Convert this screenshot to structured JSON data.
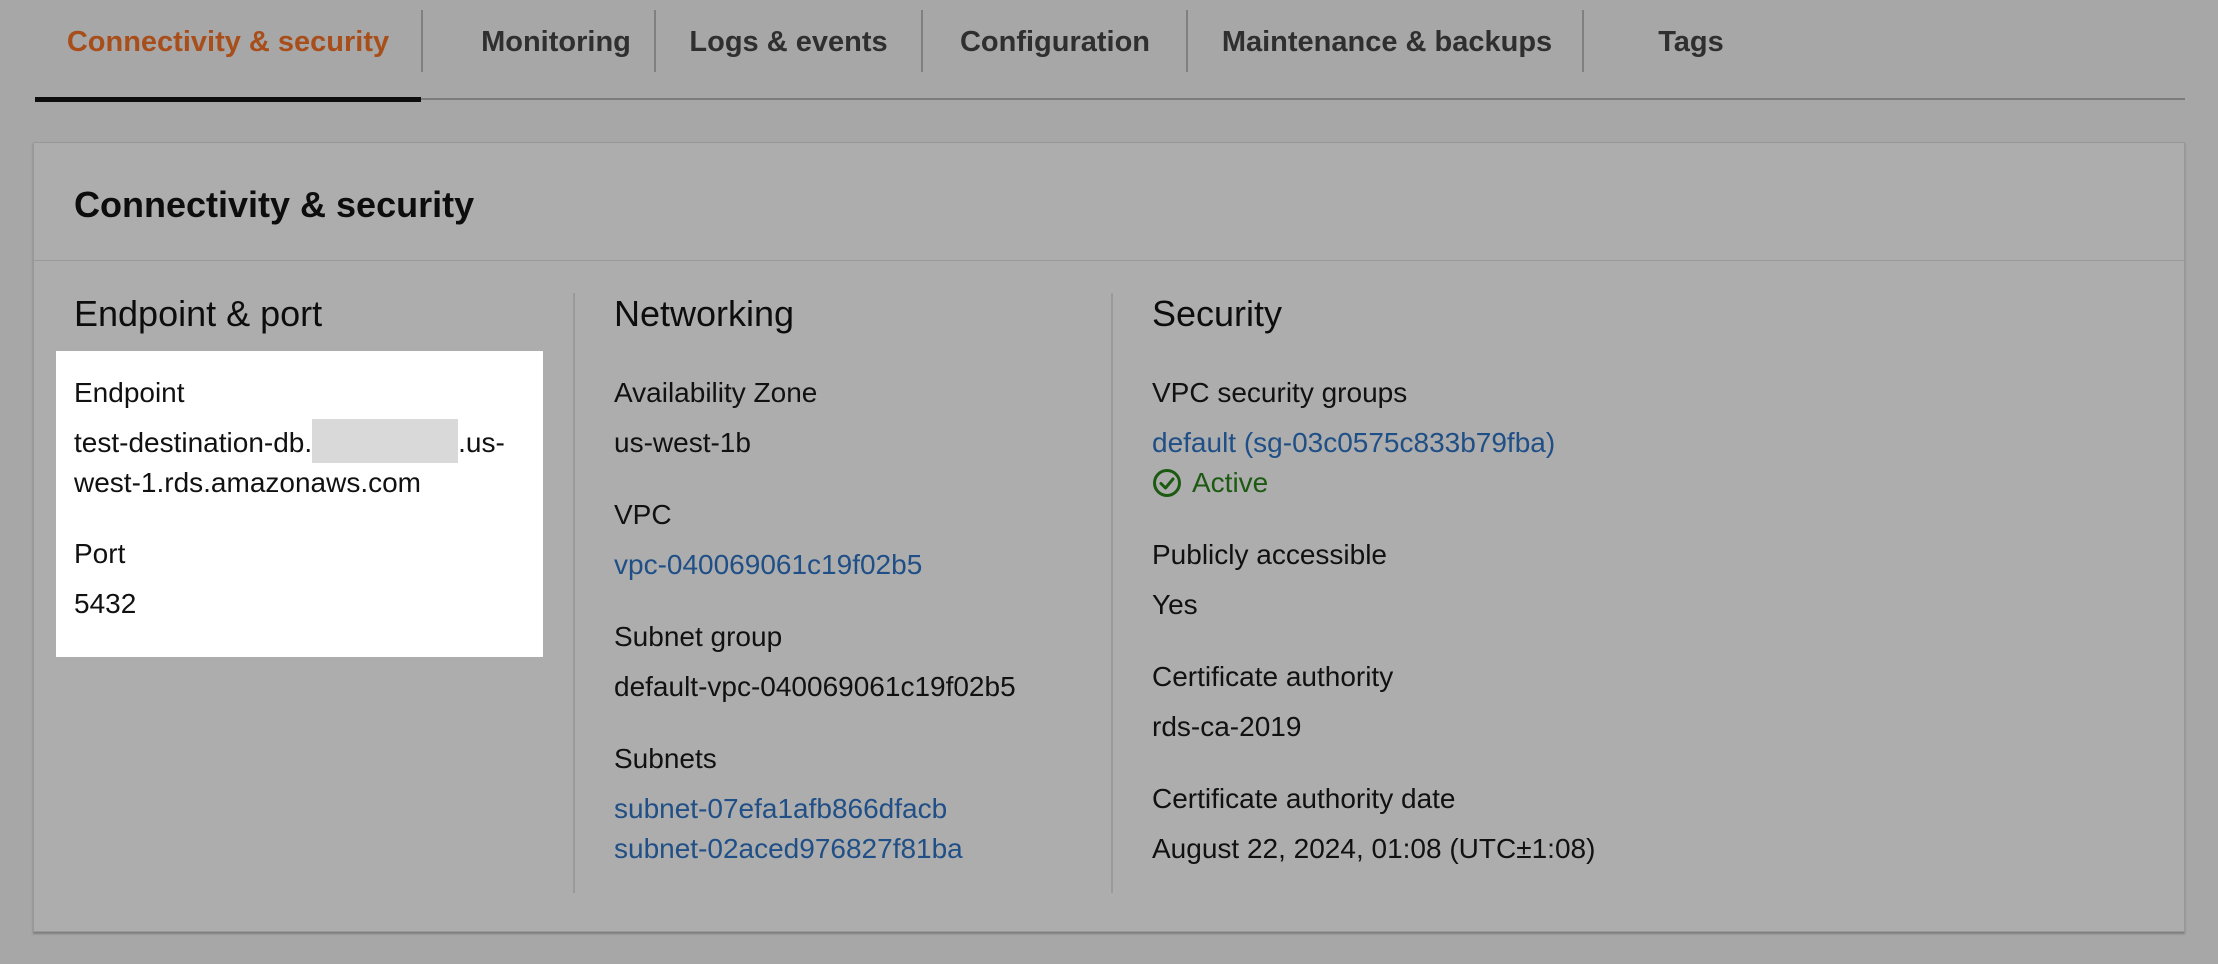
{
  "tabs": [
    {
      "label": "Connectivity & security",
      "active": true
    },
    {
      "label": "Monitoring",
      "active": false
    },
    {
      "label": "Logs & events",
      "active": false
    },
    {
      "label": "Configuration",
      "active": false
    },
    {
      "label": "Maintenance & backups",
      "active": false
    },
    {
      "label": "Tags",
      "active": false
    }
  ],
  "panel": {
    "title": "Connectivity & security"
  },
  "endpoint": {
    "heading": "Endpoint & port",
    "endpoint_label": "Endpoint",
    "endpoint_prefix": "test-destination-db.",
    "endpoint_suffix_1": ".us-",
    "endpoint_line2": "west-1.rds.amazonaws.com",
    "port_label": "Port",
    "port_value": "5432"
  },
  "networking": {
    "heading": "Networking",
    "az_label": "Availability Zone",
    "az_value": "us-west-1b",
    "vpc_label": "VPC",
    "vpc_value": "vpc-040069061c19f02b5",
    "subnet_group_label": "Subnet group",
    "subnet_group_value": "default-vpc-040069061c19f02b5",
    "subnets_label": "Subnets",
    "subnets": [
      "subnet-07efa1afb866dfacb",
      "subnet-02aced976827f81ba"
    ]
  },
  "security": {
    "heading": "Security",
    "sg_label": "VPC security groups",
    "sg_value": "default (sg-03c0575c833b79fba)",
    "sg_status": "Active",
    "public_label": "Publicly accessible",
    "public_value": "Yes",
    "ca_label": "Certificate authority",
    "ca_value": "rds-ca-2019",
    "ca_date_label": "Certificate authority date",
    "ca_date_value": "August 22, 2024, 01:08 (UTC±1:08)"
  },
  "colors": {
    "active_tab": "#a84e1b",
    "link": "#1f4f86",
    "status_active": "#1c5a12"
  }
}
